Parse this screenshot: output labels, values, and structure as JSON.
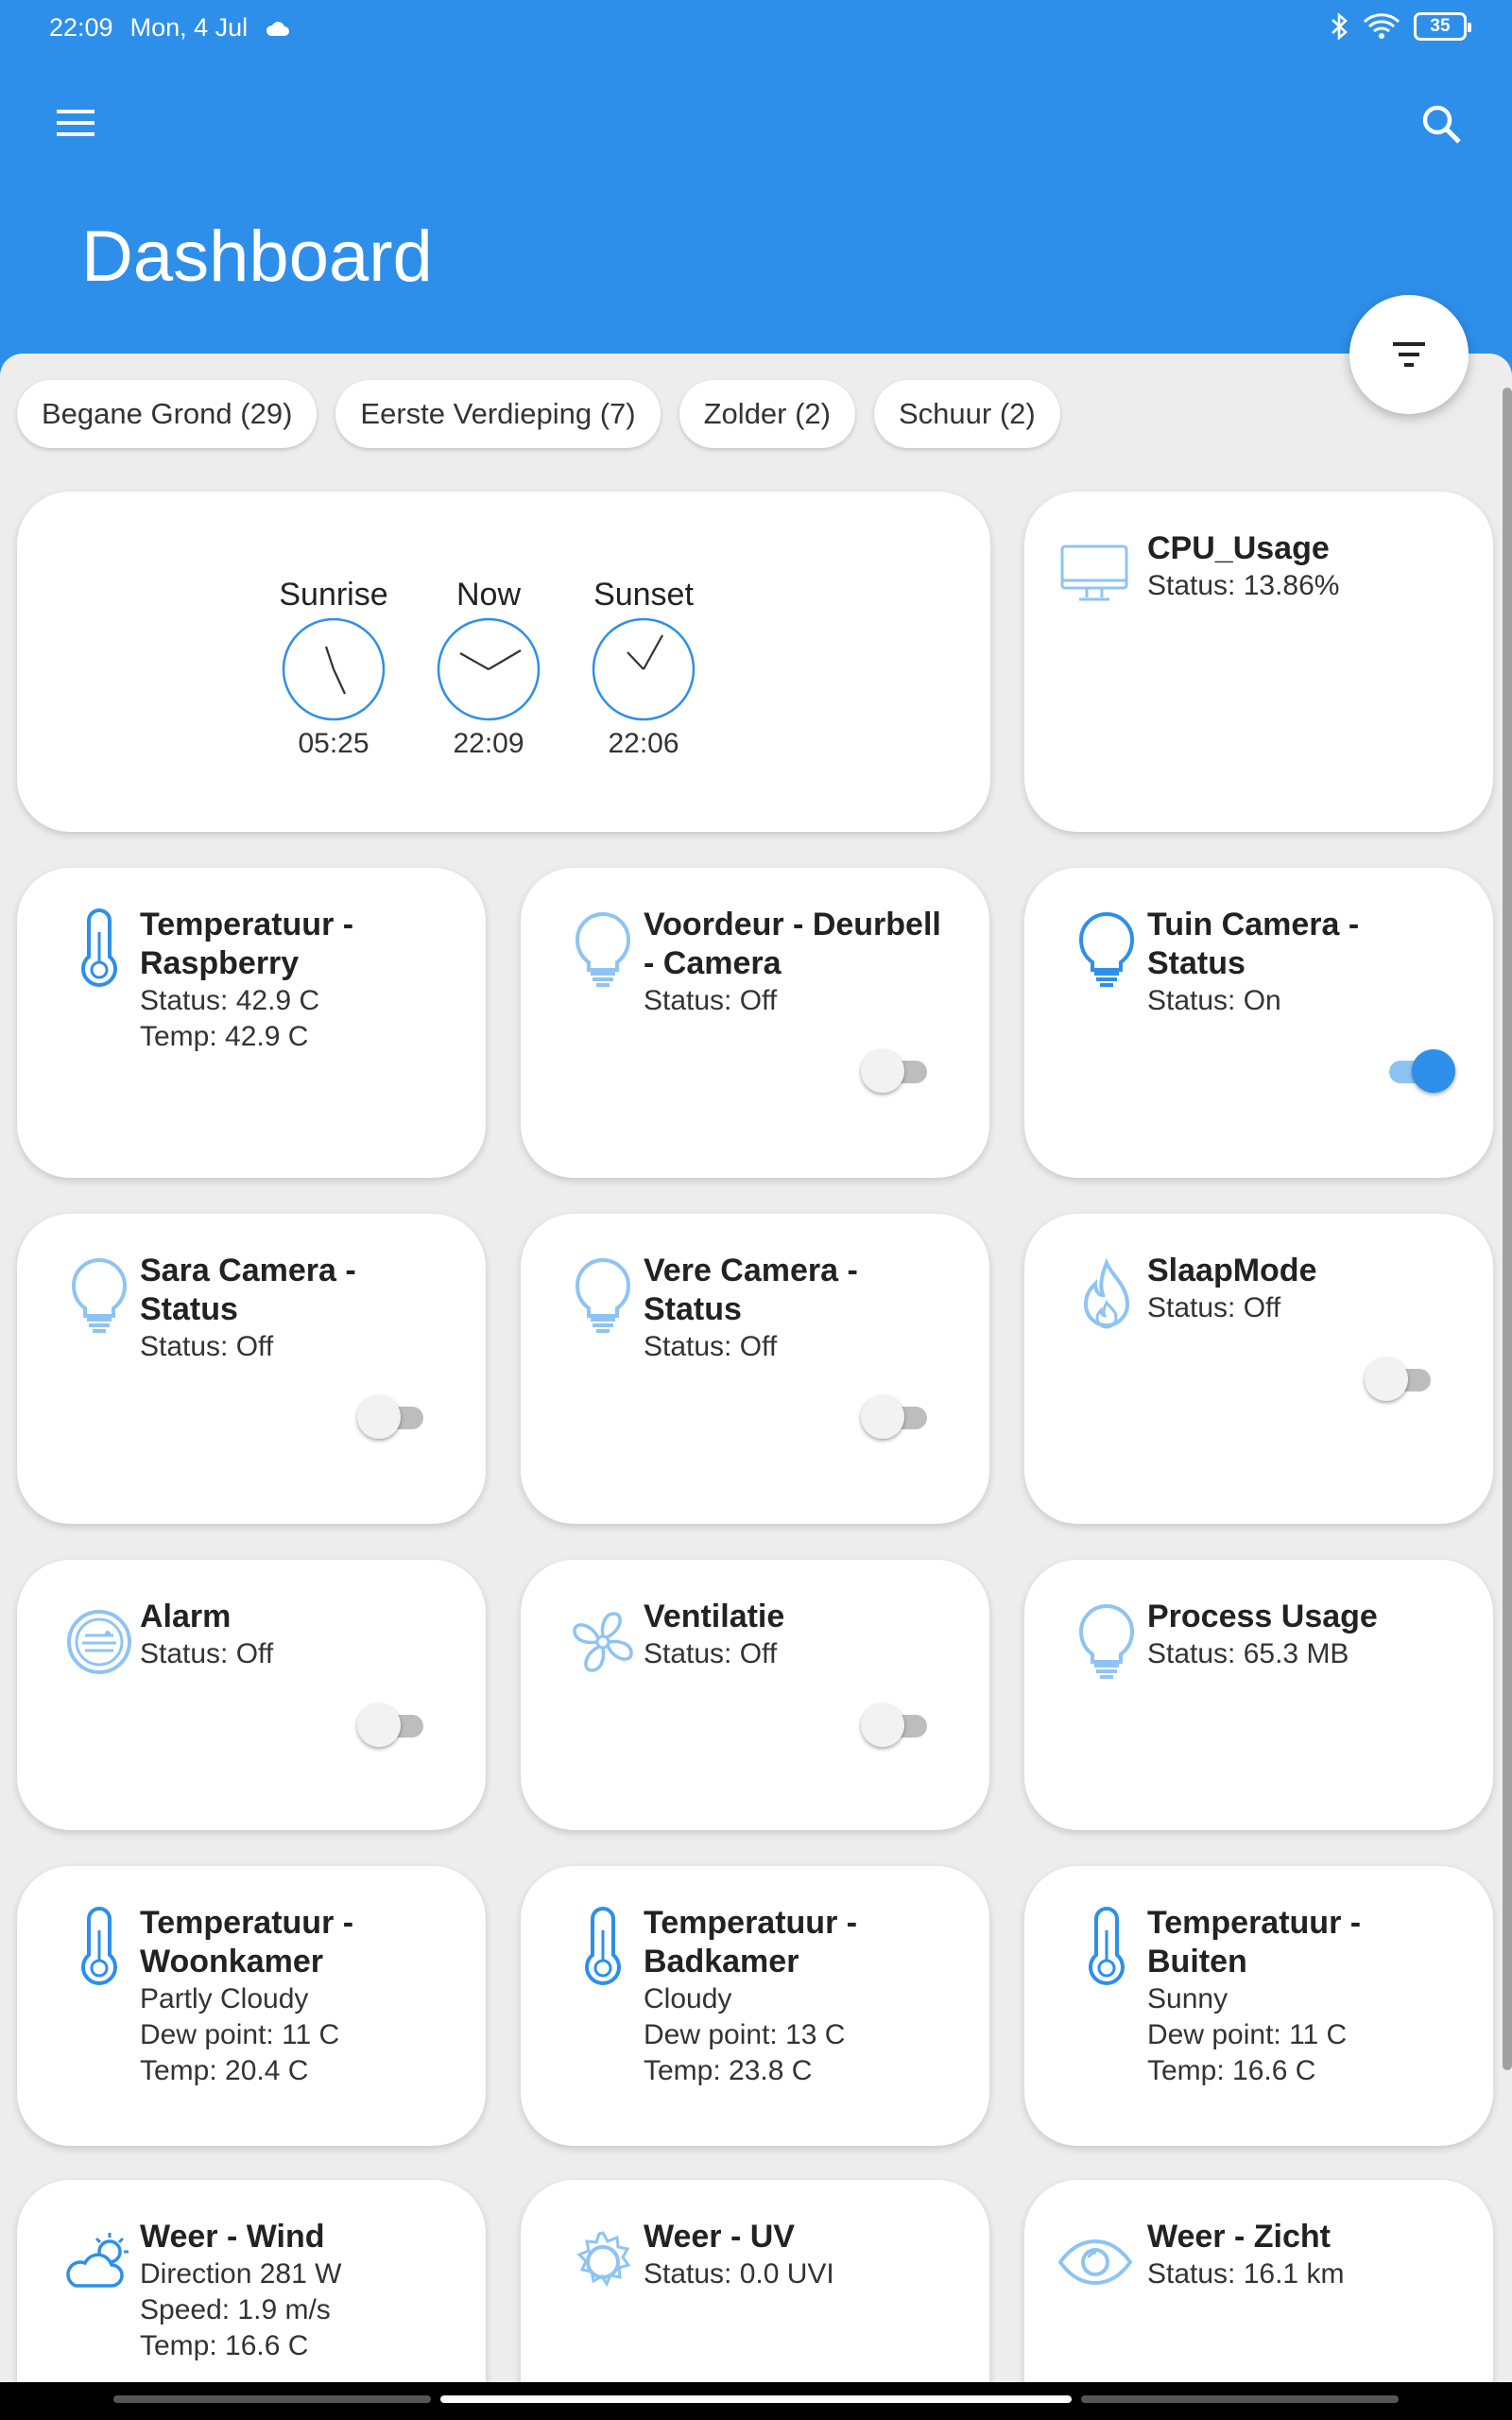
{
  "status_bar": {
    "time": "22:09",
    "date": "Mon, 4 Jul",
    "battery": "35"
  },
  "header": {
    "title": "Dashboard"
  },
  "filters": [
    {
      "label": "Begane Grond (29)"
    },
    {
      "label": "Eerste Verdieping (7)"
    },
    {
      "label": "Zolder (2)"
    },
    {
      "label": "Schuur (2)"
    }
  ],
  "sun": {
    "sunrise": {
      "label": "Sunrise",
      "time": "05:25"
    },
    "now": {
      "label": "Now",
      "time": "22:09"
    },
    "sunset": {
      "label": "Sunset",
      "time": "22:06"
    }
  },
  "cards": {
    "cpu": {
      "title": "CPU_Usage",
      "status": "Status: 13.86%",
      "icon": "monitor-icon"
    },
    "temp_raspberry": {
      "title": "Temperatuur - Raspberry",
      "status": "Status: 42.9 C",
      "temp": "Temp: 42.9 C",
      "icon": "thermometer-icon"
    },
    "voordeur": {
      "title": "Voordeur - Deurbell - Camera",
      "status": "Status: Off",
      "icon": "bulb-icon",
      "toggle_on": false
    },
    "tuin": {
      "title": "Tuin Camera - Status",
      "status": "Status: On",
      "icon": "bulb-icon",
      "toggle_on": true
    },
    "sara": {
      "title": "Sara Camera - Status",
      "status": "Status: Off",
      "icon": "bulb-icon",
      "toggle_on": false
    },
    "vere": {
      "title": "Vere Camera - Status",
      "status": "Status: Off",
      "icon": "bulb-icon",
      "toggle_on": false
    },
    "slaapmode": {
      "title": "SlaapMode",
      "status": "Status: Off",
      "icon": "flame-icon",
      "toggle_on": false
    },
    "alarm": {
      "title": "Alarm",
      "status": "Status: Off",
      "icon": "alarm-icon",
      "toggle_on": false
    },
    "ventilatie": {
      "title": "Ventilatie",
      "status": "Status: Off",
      "icon": "fan-icon",
      "toggle_on": false
    },
    "process": {
      "title": "Process Usage",
      "status": "Status: 65.3 MB",
      "icon": "bulb-icon"
    },
    "woonkamer": {
      "title": "Temperatuur - Woonkamer",
      "weather": "Partly Cloudy",
      "dew": "Dew point: 11 C",
      "temp": "Temp: 20.4 C",
      "icon": "thermometer-icon"
    },
    "badkamer": {
      "title": "Temperatuur - Badkamer",
      "weather": "Cloudy",
      "dew": "Dew point: 13 C",
      "temp": "Temp: 23.8 C",
      "icon": "thermometer-icon"
    },
    "buiten": {
      "title": "Temperatuur - Buiten",
      "weather": "Sunny",
      "dew": "Dew point: 11 C",
      "temp": "Temp: 16.6 C",
      "icon": "thermometer-icon"
    },
    "wind": {
      "title": "Weer - Wind",
      "direction": "Direction 281 W",
      "speed": "Speed: 1.9 m/s",
      "temp": "Temp: 16.6 C",
      "icon": "weather-cloud-sun-icon"
    },
    "uv": {
      "title": "Weer - UV",
      "status": "Status: 0.0 UVI",
      "icon": "sun-gear-icon"
    },
    "zicht": {
      "title": "Weer - Zicht",
      "status": "Status: 16.1 km",
      "icon": "eye-icon"
    }
  },
  "colors": {
    "primary": "#2d8fea",
    "icon_light": "#8ec4f3",
    "background": "#ededed"
  }
}
